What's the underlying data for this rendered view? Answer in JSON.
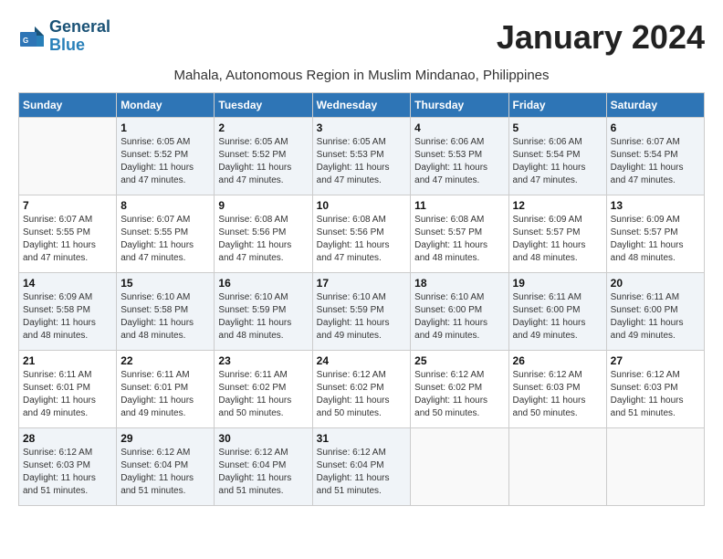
{
  "header": {
    "logo_line1": "General",
    "logo_line2": "Blue",
    "month_title": "January 2024",
    "location": "Mahala, Autonomous Region in Muslim Mindanao, Philippines"
  },
  "weekdays": [
    "Sunday",
    "Monday",
    "Tuesday",
    "Wednesday",
    "Thursday",
    "Friday",
    "Saturday"
  ],
  "weeks": [
    [
      {
        "day": "",
        "sunrise": "",
        "sunset": "",
        "daylight": ""
      },
      {
        "day": "1",
        "sunrise": "Sunrise: 6:05 AM",
        "sunset": "Sunset: 5:52 PM",
        "daylight": "Daylight: 11 hours and 47 minutes."
      },
      {
        "day": "2",
        "sunrise": "Sunrise: 6:05 AM",
        "sunset": "Sunset: 5:52 PM",
        "daylight": "Daylight: 11 hours and 47 minutes."
      },
      {
        "day": "3",
        "sunrise": "Sunrise: 6:05 AM",
        "sunset": "Sunset: 5:53 PM",
        "daylight": "Daylight: 11 hours and 47 minutes."
      },
      {
        "day": "4",
        "sunrise": "Sunrise: 6:06 AM",
        "sunset": "Sunset: 5:53 PM",
        "daylight": "Daylight: 11 hours and 47 minutes."
      },
      {
        "day": "5",
        "sunrise": "Sunrise: 6:06 AM",
        "sunset": "Sunset: 5:54 PM",
        "daylight": "Daylight: 11 hours and 47 minutes."
      },
      {
        "day": "6",
        "sunrise": "Sunrise: 6:07 AM",
        "sunset": "Sunset: 5:54 PM",
        "daylight": "Daylight: 11 hours and 47 minutes."
      }
    ],
    [
      {
        "day": "7",
        "sunrise": "Sunrise: 6:07 AM",
        "sunset": "Sunset: 5:55 PM",
        "daylight": "Daylight: 11 hours and 47 minutes."
      },
      {
        "day": "8",
        "sunrise": "Sunrise: 6:07 AM",
        "sunset": "Sunset: 5:55 PM",
        "daylight": "Daylight: 11 hours and 47 minutes."
      },
      {
        "day": "9",
        "sunrise": "Sunrise: 6:08 AM",
        "sunset": "Sunset: 5:56 PM",
        "daylight": "Daylight: 11 hours and 47 minutes."
      },
      {
        "day": "10",
        "sunrise": "Sunrise: 6:08 AM",
        "sunset": "Sunset: 5:56 PM",
        "daylight": "Daylight: 11 hours and 47 minutes."
      },
      {
        "day": "11",
        "sunrise": "Sunrise: 6:08 AM",
        "sunset": "Sunset: 5:57 PM",
        "daylight": "Daylight: 11 hours and 48 minutes."
      },
      {
        "day": "12",
        "sunrise": "Sunrise: 6:09 AM",
        "sunset": "Sunset: 5:57 PM",
        "daylight": "Daylight: 11 hours and 48 minutes."
      },
      {
        "day": "13",
        "sunrise": "Sunrise: 6:09 AM",
        "sunset": "Sunset: 5:57 PM",
        "daylight": "Daylight: 11 hours and 48 minutes."
      }
    ],
    [
      {
        "day": "14",
        "sunrise": "Sunrise: 6:09 AM",
        "sunset": "Sunset: 5:58 PM",
        "daylight": "Daylight: 11 hours and 48 minutes."
      },
      {
        "day": "15",
        "sunrise": "Sunrise: 6:10 AM",
        "sunset": "Sunset: 5:58 PM",
        "daylight": "Daylight: 11 hours and 48 minutes."
      },
      {
        "day": "16",
        "sunrise": "Sunrise: 6:10 AM",
        "sunset": "Sunset: 5:59 PM",
        "daylight": "Daylight: 11 hours and 48 minutes."
      },
      {
        "day": "17",
        "sunrise": "Sunrise: 6:10 AM",
        "sunset": "Sunset: 5:59 PM",
        "daylight": "Daylight: 11 hours and 49 minutes."
      },
      {
        "day": "18",
        "sunrise": "Sunrise: 6:10 AM",
        "sunset": "Sunset: 6:00 PM",
        "daylight": "Daylight: 11 hours and 49 minutes."
      },
      {
        "day": "19",
        "sunrise": "Sunrise: 6:11 AM",
        "sunset": "Sunset: 6:00 PM",
        "daylight": "Daylight: 11 hours and 49 minutes."
      },
      {
        "day": "20",
        "sunrise": "Sunrise: 6:11 AM",
        "sunset": "Sunset: 6:00 PM",
        "daylight": "Daylight: 11 hours and 49 minutes."
      }
    ],
    [
      {
        "day": "21",
        "sunrise": "Sunrise: 6:11 AM",
        "sunset": "Sunset: 6:01 PM",
        "daylight": "Daylight: 11 hours and 49 minutes."
      },
      {
        "day": "22",
        "sunrise": "Sunrise: 6:11 AM",
        "sunset": "Sunset: 6:01 PM",
        "daylight": "Daylight: 11 hours and 49 minutes."
      },
      {
        "day": "23",
        "sunrise": "Sunrise: 6:11 AM",
        "sunset": "Sunset: 6:02 PM",
        "daylight": "Daylight: 11 hours and 50 minutes."
      },
      {
        "day": "24",
        "sunrise": "Sunrise: 6:12 AM",
        "sunset": "Sunset: 6:02 PM",
        "daylight": "Daylight: 11 hours and 50 minutes."
      },
      {
        "day": "25",
        "sunrise": "Sunrise: 6:12 AM",
        "sunset": "Sunset: 6:02 PM",
        "daylight": "Daylight: 11 hours and 50 minutes."
      },
      {
        "day": "26",
        "sunrise": "Sunrise: 6:12 AM",
        "sunset": "Sunset: 6:03 PM",
        "daylight": "Daylight: 11 hours and 50 minutes."
      },
      {
        "day": "27",
        "sunrise": "Sunrise: 6:12 AM",
        "sunset": "Sunset: 6:03 PM",
        "daylight": "Daylight: 11 hours and 51 minutes."
      }
    ],
    [
      {
        "day": "28",
        "sunrise": "Sunrise: 6:12 AM",
        "sunset": "Sunset: 6:03 PM",
        "daylight": "Daylight: 11 hours and 51 minutes."
      },
      {
        "day": "29",
        "sunrise": "Sunrise: 6:12 AM",
        "sunset": "Sunset: 6:04 PM",
        "daylight": "Daylight: 11 hours and 51 minutes."
      },
      {
        "day": "30",
        "sunrise": "Sunrise: 6:12 AM",
        "sunset": "Sunset: 6:04 PM",
        "daylight": "Daylight: 11 hours and 51 minutes."
      },
      {
        "day": "31",
        "sunrise": "Sunrise: 6:12 AM",
        "sunset": "Sunset: 6:04 PM",
        "daylight": "Daylight: 11 hours and 51 minutes."
      },
      {
        "day": "",
        "sunrise": "",
        "sunset": "",
        "daylight": ""
      },
      {
        "day": "",
        "sunrise": "",
        "sunset": "",
        "daylight": ""
      },
      {
        "day": "",
        "sunrise": "",
        "sunset": "",
        "daylight": ""
      }
    ]
  ]
}
